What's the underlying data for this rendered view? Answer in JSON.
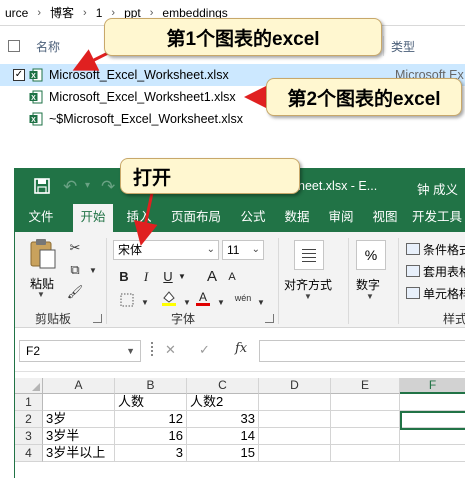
{
  "explorer": {
    "breadcrumb": [
      "urce",
      "博客",
      "1",
      "ppt",
      "embeddings"
    ],
    "columns": {
      "name": "名称",
      "type": "类型"
    },
    "files": [
      {
        "name": "Microsoft_Excel_Worksheet.xlsx",
        "type": "Microsoft Ex",
        "selected": true
      },
      {
        "name": "Microsoft_Excel_Worksheet1.xlsx",
        "type": ""
      },
      {
        "name": "~$Microsoft_Excel_Worksheet.xlsx",
        "type": ""
      }
    ]
  },
  "excel": {
    "title": "heet.xlsx - E...",
    "user": "钟 成义",
    "tabs": [
      "文件",
      "开始",
      "插入",
      "页面布局",
      "公式",
      "数据",
      "审阅",
      "视图",
      "开发工具"
    ],
    "active_tab": "开始",
    "ribbon": {
      "clipboard": {
        "paste": "粘贴",
        "label": "剪贴板"
      },
      "font": {
        "name": "宋体",
        "size": "11",
        "bold": "B",
        "italic": "I",
        "underline": "U",
        "grow": "A",
        "shrink": "A",
        "phonetic": "wén",
        "label": "字体"
      },
      "alignment": {
        "label": "对齐方式"
      },
      "number": {
        "symbol": "%",
        "label": "数字"
      },
      "styles": {
        "conditional": "条件格式",
        "table": "套用表格",
        "cell": "单元格样",
        "label": "样式"
      }
    },
    "name_box": "F2",
    "formula_buttons": {
      "cancel": "✕",
      "confirm": "✓",
      "fx": "fx"
    },
    "columns": [
      "A",
      "B",
      "C",
      "D",
      "E",
      "F"
    ],
    "selected_column": "F",
    "rows": [
      {
        "n": "1",
        "cells": [
          "",
          "人数",
          "人数2",
          "",
          "",
          ""
        ]
      },
      {
        "n": "2",
        "cells": [
          "3岁",
          "12",
          "33",
          "",
          "",
          ""
        ]
      },
      {
        "n": "3",
        "cells": [
          "3岁半",
          "16",
          "14",
          "",
          "",
          ""
        ]
      },
      {
        "n": "4",
        "cells": [
          "3岁半以上",
          "3",
          "15",
          "",
          "",
          ""
        ]
      }
    ]
  },
  "callouts": {
    "first_chart": "第1个图表的excel",
    "second_chart": "第2个图表的excel",
    "open": "打开"
  },
  "colors": {
    "excel_green": "#217346",
    "selection": "#cce8ff",
    "callout_fill": "#fff7d0",
    "arrow": "#e02020"
  }
}
